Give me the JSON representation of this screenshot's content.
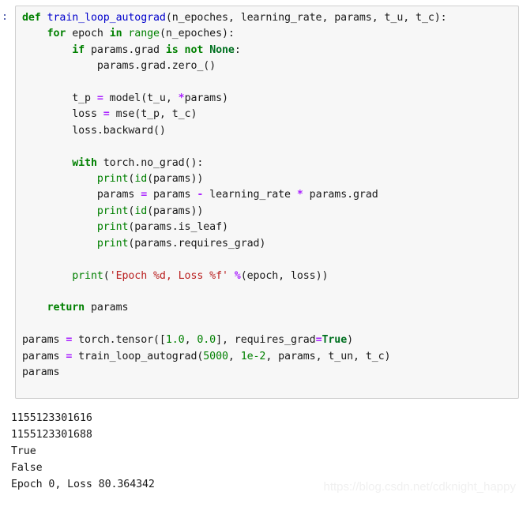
{
  "cell": {
    "prompt": ":",
    "code_lines": [
      {
        "indent": 0,
        "tokens": [
          {
            "t": "def ",
            "c": "k"
          },
          {
            "t": "train_loop_autograd",
            "c": "nf"
          },
          {
            "t": "(n_epoches, learning_rate, params, t_u, t_c):",
            "c": "n"
          }
        ]
      },
      {
        "indent": 1,
        "tokens": [
          {
            "t": "for ",
            "c": "k"
          },
          {
            "t": "epoch ",
            "c": "n"
          },
          {
            "t": "in ",
            "c": "k"
          },
          {
            "t": "range",
            "c": "nb"
          },
          {
            "t": "(n_epoches):",
            "c": "n"
          }
        ]
      },
      {
        "indent": 2,
        "tokens": [
          {
            "t": "if ",
            "c": "k"
          },
          {
            "t": "params.grad ",
            "c": "n"
          },
          {
            "t": "is not ",
            "c": "k"
          },
          {
            "t": "None",
            "c": "kc"
          },
          {
            "t": ":",
            "c": "n"
          }
        ]
      },
      {
        "indent": 3,
        "tokens": [
          {
            "t": "params.grad.zero_()",
            "c": "n"
          }
        ]
      },
      {
        "indent": 0,
        "tokens": []
      },
      {
        "indent": 2,
        "tokens": [
          {
            "t": "t_p ",
            "c": "n"
          },
          {
            "t": "=",
            "c": "o"
          },
          {
            "t": " model(t_u, ",
            "c": "n"
          },
          {
            "t": "*",
            "c": "o"
          },
          {
            "t": "params)",
            "c": "n"
          }
        ]
      },
      {
        "indent": 2,
        "tokens": [
          {
            "t": "loss ",
            "c": "n"
          },
          {
            "t": "=",
            "c": "o"
          },
          {
            "t": " mse(t_p, t_c)",
            "c": "n"
          }
        ]
      },
      {
        "indent": 2,
        "tokens": [
          {
            "t": "loss.backward()",
            "c": "n"
          }
        ]
      },
      {
        "indent": 0,
        "tokens": []
      },
      {
        "indent": 2,
        "tokens": [
          {
            "t": "with ",
            "c": "k"
          },
          {
            "t": "torch.no_grad():",
            "c": "n"
          }
        ]
      },
      {
        "indent": 3,
        "tokens": [
          {
            "t": "print",
            "c": "nb"
          },
          {
            "t": "(",
            "c": "n"
          },
          {
            "t": "id",
            "c": "nb"
          },
          {
            "t": "(params))",
            "c": "n"
          }
        ]
      },
      {
        "indent": 3,
        "tokens": [
          {
            "t": "params ",
            "c": "n"
          },
          {
            "t": "=",
            "c": "o"
          },
          {
            "t": " params ",
            "c": "n"
          },
          {
            "t": "-",
            "c": "o"
          },
          {
            "t": " learning_rate ",
            "c": "n"
          },
          {
            "t": "*",
            "c": "o"
          },
          {
            "t": " params.grad",
            "c": "n"
          }
        ]
      },
      {
        "indent": 3,
        "tokens": [
          {
            "t": "print",
            "c": "nb"
          },
          {
            "t": "(",
            "c": "n"
          },
          {
            "t": "id",
            "c": "nb"
          },
          {
            "t": "(params))",
            "c": "n"
          }
        ]
      },
      {
        "indent": 3,
        "tokens": [
          {
            "t": "print",
            "c": "nb"
          },
          {
            "t": "(params.is_leaf)",
            "c": "n"
          }
        ]
      },
      {
        "indent": 3,
        "tokens": [
          {
            "t": "print",
            "c": "nb"
          },
          {
            "t": "(params.requires_grad)",
            "c": "n"
          }
        ]
      },
      {
        "indent": 0,
        "tokens": []
      },
      {
        "indent": 2,
        "tokens": [
          {
            "t": "print",
            "c": "nb"
          },
          {
            "t": "(",
            "c": "n"
          },
          {
            "t": "'Epoch %d, Loss %f'",
            "c": "s"
          },
          {
            "t": " ",
            "c": "n"
          },
          {
            "t": "%",
            "c": "o"
          },
          {
            "t": "(epoch, loss))",
            "c": "n"
          }
        ]
      },
      {
        "indent": 0,
        "tokens": []
      },
      {
        "indent": 1,
        "tokens": [
          {
            "t": "return ",
            "c": "k"
          },
          {
            "t": "params",
            "c": "n"
          }
        ]
      },
      {
        "indent": 0,
        "tokens": []
      },
      {
        "indent": 0,
        "tokens": [
          {
            "t": "params ",
            "c": "n"
          },
          {
            "t": "=",
            "c": "o"
          },
          {
            "t": " torch.tensor([",
            "c": "n"
          },
          {
            "t": "1.0",
            "c": "m"
          },
          {
            "t": ", ",
            "c": "n"
          },
          {
            "t": "0.0",
            "c": "m"
          },
          {
            "t": "], requires_grad",
            "c": "n"
          },
          {
            "t": "=",
            "c": "o"
          },
          {
            "t": "True",
            "c": "kc"
          },
          {
            "t": ")",
            "c": "n"
          }
        ]
      },
      {
        "indent": 0,
        "tokens": [
          {
            "t": "params ",
            "c": "n"
          },
          {
            "t": "=",
            "c": "o"
          },
          {
            "t": " train_loop_autograd(",
            "c": "n"
          },
          {
            "t": "5000",
            "c": "m"
          },
          {
            "t": ", ",
            "c": "n"
          },
          {
            "t": "1e-2",
            "c": "m"
          },
          {
            "t": ", params, t_un, t_c)",
            "c": "n"
          }
        ]
      },
      {
        "indent": 0,
        "tokens": [
          {
            "t": "params",
            "c": "n"
          }
        ]
      }
    ]
  },
  "output": {
    "lines": [
      "1155123301616",
      "1155123301688",
      "True",
      "False",
      "Epoch 0, Loss 80.364342"
    ]
  },
  "watermark": {
    "text": "https://blog.csdn.net/cdknight_happy"
  },
  "colors": {
    "keyword": "#008000",
    "constant": "#007020",
    "function": "#0000CC",
    "operator": "#AA22FF",
    "string": "#BA2121",
    "number": "#008000",
    "text": "#1a1a1a",
    "cell_background": "#f7f7f7",
    "cell_border": "#cfcfcf",
    "prompt": "#303F9F",
    "watermark": "#f0f0f0"
  }
}
